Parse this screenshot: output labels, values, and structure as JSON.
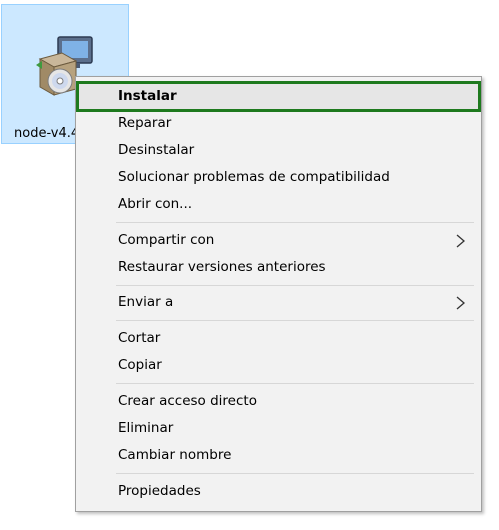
{
  "desktop": {
    "file": {
      "label": "node-v4.4",
      "icon": "installer-package-icon",
      "selected": true
    }
  },
  "context_menu": {
    "items": [
      {
        "label": "Instalar",
        "bold": true,
        "highlighted": true
      },
      {
        "label": "Reparar"
      },
      {
        "label": "Desinstalar"
      },
      {
        "label": "Solucionar problemas de compatibilidad"
      },
      {
        "label": "Abrir con..."
      },
      {
        "label": "Compartir con",
        "submenu_icon": "chevron-right-icon"
      },
      {
        "label": "Restaurar versiones anteriores"
      },
      {
        "label": "Enviar a",
        "submenu_icon": "chevron-right-icon"
      },
      {
        "label": "Cortar"
      },
      {
        "label": "Copiar"
      },
      {
        "label": "Crear acceso directo"
      },
      {
        "label": "Eliminar"
      },
      {
        "label": "Cambiar nombre"
      },
      {
        "label": "Propiedades"
      }
    ]
  },
  "colors": {
    "menu_background": "#f2f2f2",
    "highlight_outline": "#1e7a1e",
    "selection_background": "#cce8ff",
    "selection_border": "#99d1ff"
  }
}
